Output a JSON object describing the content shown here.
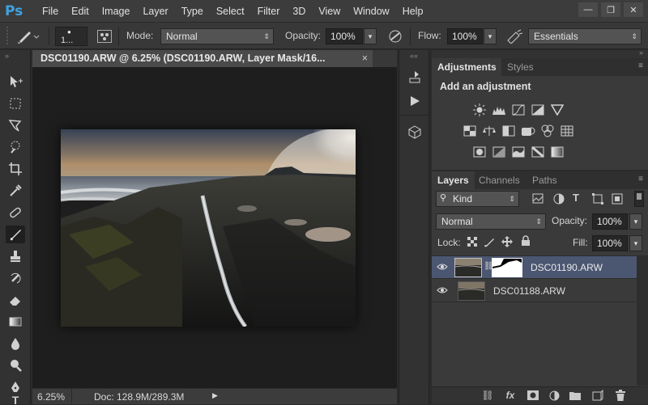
{
  "app": {
    "logo": "Ps"
  },
  "menu": [
    "File",
    "Edit",
    "Image",
    "Layer",
    "Type",
    "Select",
    "Filter",
    "3D",
    "View",
    "Window",
    "Help"
  ],
  "window_controls": {
    "minimize": "—",
    "restore": "❐",
    "close": "✕"
  },
  "options_bar": {
    "brush_size": "1...",
    "mode_label": "Mode:",
    "mode_value": "Normal",
    "opacity_label": "Opacity:",
    "opacity_value": "100%",
    "flow_label": "Flow:",
    "flow_value": "100%",
    "workspace": "Essentials"
  },
  "document": {
    "tab_title": "DSC01190.ARW @ 6.25% (DSC01190.ARW, Layer Mask/16...",
    "close": "×",
    "zoom": "6.25%",
    "doc_info": "Doc: 128.9M/289.3M"
  },
  "adjustments_panel": {
    "tabs": [
      "Adjustments",
      "Styles"
    ],
    "heading": "Add an adjustment",
    "icons_row1": [
      "brightness-contrast-icon",
      "levels-icon",
      "curves-icon",
      "exposure-icon",
      "vibrance-icon"
    ],
    "icons_row2": [
      "hue-saturation-icon",
      "color-balance-icon",
      "black-white-icon",
      "photo-filter-icon",
      "channel-mixer-icon",
      "color-lookup-icon"
    ],
    "icons_row3": [
      "invert-icon",
      "posterize-icon",
      "threshold-icon",
      "selective-color-icon",
      "gradient-map-icon"
    ]
  },
  "layers_panel": {
    "tabs": [
      "Layers",
      "Channels",
      "Paths"
    ],
    "filter_kind": "Kind",
    "blend_mode": "Normal",
    "opacity_label": "Opacity:",
    "opacity_value": "100%",
    "lock_label": "Lock:",
    "fill_label": "Fill:",
    "fill_value": "100%",
    "layers": [
      {
        "name": "DSC01190.ARW",
        "selected": true,
        "has_mask": true
      },
      {
        "name": "DSC01188.ARW",
        "selected": false,
        "has_mask": false
      }
    ],
    "footer_icons": [
      "link-layers-icon",
      "fx-icon",
      "add-mask-icon",
      "adjustment-layer-icon",
      "new-group-icon",
      "new-layer-icon",
      "delete-layer-icon"
    ]
  },
  "colors": {
    "accent": "#3fa2e0",
    "selected_layer": "#4b5671"
  }
}
